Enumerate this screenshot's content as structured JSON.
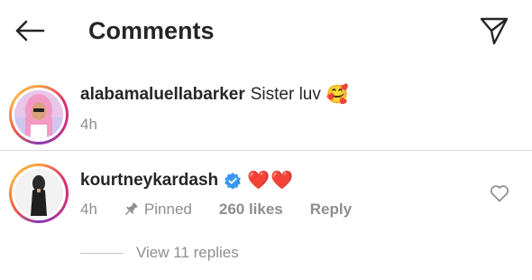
{
  "header": {
    "title": "Comments",
    "back_icon": "arrow-left-icon",
    "share_icon": "paper-plane-icon"
  },
  "caption": {
    "username": "alabamaluellabarker",
    "text": "Sister luv",
    "emoji": "🥰",
    "time": "4h"
  },
  "comment": {
    "username": "kourtneykardash",
    "verified": true,
    "hearts": [
      "❤️",
      "❤️"
    ],
    "time": "4h",
    "pinned_label": "Pinned",
    "likes": "260 likes",
    "reply_label": "Reply",
    "view_replies": "View 11 replies"
  },
  "colors": {
    "text": "#262626",
    "secondary": "#8e8e8e",
    "verified": "#3897f0",
    "heart": "#ed4956",
    "divider": "#dbdbdb"
  }
}
